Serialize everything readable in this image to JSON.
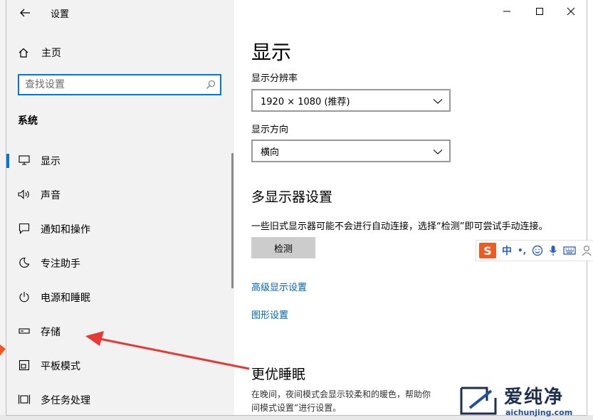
{
  "window": {
    "title": "设置",
    "controls": {
      "minimize": "minimize",
      "maximize": "maximize",
      "close": "close"
    }
  },
  "sidebar": {
    "home_label": "主页",
    "search": {
      "placeholder": "查找设置",
      "value": ""
    },
    "section": "系统",
    "items": [
      {
        "label": "显示",
        "icon": "monitor-icon",
        "selected": true
      },
      {
        "label": "声音",
        "icon": "speaker-icon",
        "selected": false
      },
      {
        "label": "通知和操作",
        "icon": "notification-icon",
        "selected": false
      },
      {
        "label": "专注助手",
        "icon": "moon-icon",
        "selected": false
      },
      {
        "label": "电源和睡眠",
        "icon": "power-icon",
        "selected": false
      },
      {
        "label": "存储",
        "icon": "storage-icon",
        "selected": false
      },
      {
        "label": "平板模式",
        "icon": "tablet-icon",
        "selected": false
      },
      {
        "label": "多任务处理",
        "icon": "multitask-icon",
        "selected": false
      }
    ]
  },
  "main": {
    "title": "显示",
    "resolution": {
      "label": "显示分辨率",
      "value": "1920 × 1080 (推荐)"
    },
    "orientation": {
      "label": "显示方向",
      "value": "横向"
    },
    "multi_display": {
      "heading": "多显示器设置",
      "description": "一些旧式显示器可能不会进行自动连接，选择“检测”即可尝试手动连接。",
      "detect_button": "检测"
    },
    "links": {
      "advanced": "高级显示设置",
      "graphics": "图形设置"
    },
    "better_sleep": {
      "heading": "更优睡眠",
      "line1": "在晚间，夜间模式会显示较柔和的暖色，帮助你",
      "line2": "间模式设置”进行设置。"
    }
  },
  "ime": {
    "s_label": "S",
    "lang": "中",
    "punct": "•,",
    "icons": [
      "emoji-icon",
      "mic-icon",
      "keyboard-icon",
      "user-icon"
    ]
  },
  "watermark": {
    "cn": "爱纯净",
    "url": "aichunjing.com"
  },
  "colors": {
    "accent": "#0078d7",
    "link": "#0063b1",
    "arrow": "#e53935"
  }
}
